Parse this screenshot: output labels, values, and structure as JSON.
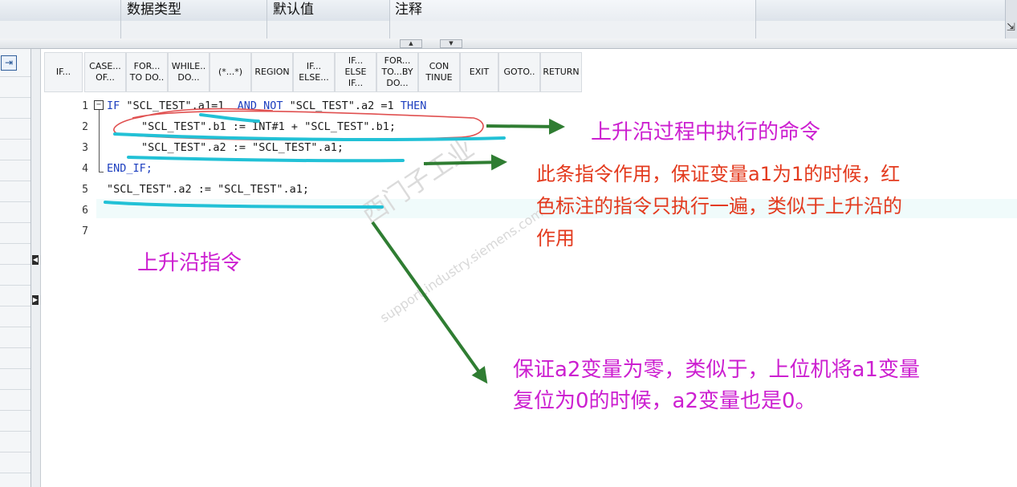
{
  "table_header": {
    "data_type": "数据类型",
    "default_value": "默认值",
    "comment": "注释"
  },
  "toolbar": {
    "buttons": [
      "IF...",
      "CASE...\nOF...",
      "FOR...\nTO DO..",
      "WHILE..\nDO...",
      "(*...*)",
      "REGION",
      "IF...\nELSE...",
      "IF...\nELSE\nIF...",
      "FOR...\nTO...BY\nDO...",
      "CON\nTINUE",
      "EXIT",
      "GOTO..",
      "RETURN"
    ]
  },
  "code": {
    "line_numbers": [
      "1",
      "2",
      "3",
      "4",
      "5",
      "6",
      "7"
    ],
    "line1": {
      "kw_if": "IF",
      "a": "\"SCL_TEST\".a1=1",
      "kw_and_not": "AND NOT",
      "b": "\"SCL_TEST\".a2 =1",
      "kw_then": "THEN"
    },
    "line2": "\"SCL_TEST\".b1 := INT#1 + \"SCL_TEST\".b1;",
    "line3": "\"SCL_TEST\".a2 := \"SCL_TEST\".a1;",
    "line4": "END_IF;",
    "line5": "\"SCL_TEST\".a2 := \"SCL_TEST\".a1;"
  },
  "annotations": {
    "rising_edge_command": "上升沿过程中执行的命令",
    "instruction_effect_line1": "此条指令作用，保证变量a1为1的时候，红",
    "instruction_effect_line2": "色标注的指令只执行一遍，类似于上升沿的",
    "instruction_effect_line3": "作用",
    "rising_edge_instruction": "上升沿指令",
    "reset_note_line1": "保证a2变量为零，类似于，上位机将a1变量",
    "reset_note_line2": "复位为0的时候，a2变量也是0。"
  },
  "watermark": {
    "main": "西门子工业",
    "sub": "support.industry.siemens.com"
  },
  "colors": {
    "annotation_magenta": "#cc1fd0",
    "annotation_red": "#e33a1e",
    "arrow_green": "#2f7d32",
    "underline_cyan": "#22c1d6",
    "circle_red": "#e05050",
    "keyword_blue": "#1d3fbf"
  }
}
